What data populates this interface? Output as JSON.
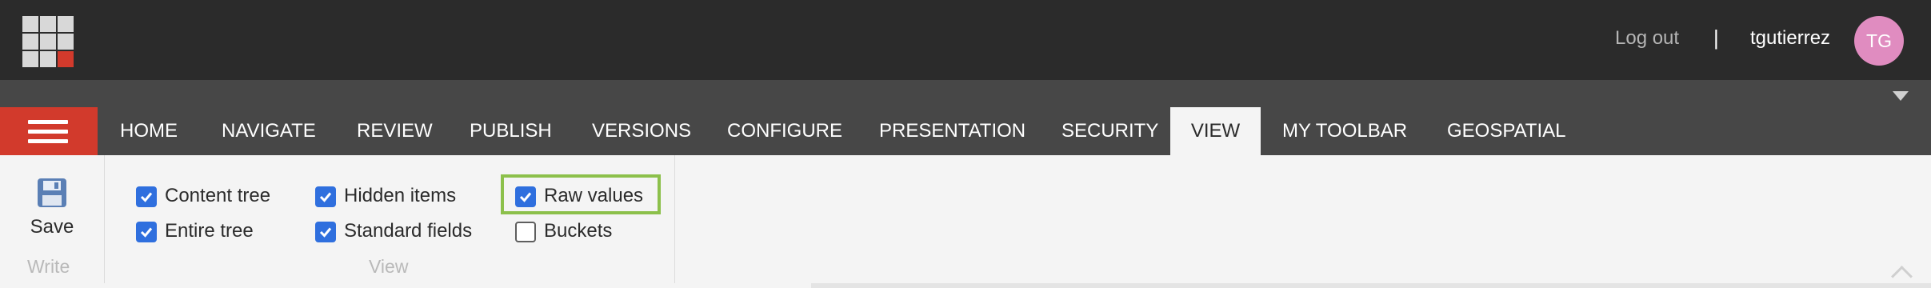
{
  "header": {
    "logout_label": "Log out",
    "separator": "|",
    "username": "tgutierrez",
    "avatar_initials": "TG",
    "avatar_color": "#e08cc0"
  },
  "tabs": [
    {
      "label": "HOME",
      "active": false
    },
    {
      "label": "NAVIGATE",
      "active": false
    },
    {
      "label": "REVIEW",
      "active": false
    },
    {
      "label": "PUBLISH",
      "active": false
    },
    {
      "label": "VERSIONS",
      "active": false
    },
    {
      "label": "CONFIGURE",
      "active": false
    },
    {
      "label": "PRESENTATION",
      "active": false
    },
    {
      "label": "SECURITY",
      "active": false
    },
    {
      "label": "VIEW",
      "active": true
    },
    {
      "label": "MY TOOLBAR",
      "active": false
    },
    {
      "label": "GEOSPATIAL",
      "active": false
    }
  ],
  "ribbon": {
    "write_group": {
      "label": "Write",
      "save_label": "Save"
    },
    "view_group": {
      "label": "View",
      "options": [
        {
          "label": "Content tree",
          "checked": true
        },
        {
          "label": "Entire tree",
          "checked": true
        },
        {
          "label": "Hidden items",
          "checked": true
        },
        {
          "label": "Standard fields",
          "checked": true
        },
        {
          "label": "Raw values",
          "checked": true,
          "highlighted": true
        },
        {
          "label": "Buckets",
          "checked": false
        }
      ]
    }
  },
  "colors": {
    "topbar": "#2b2b2b",
    "tabbar": "#474747",
    "accent_red": "#d23a2c",
    "checkbox_blue": "#2f6fde",
    "highlight_green": "#8cc04b"
  }
}
